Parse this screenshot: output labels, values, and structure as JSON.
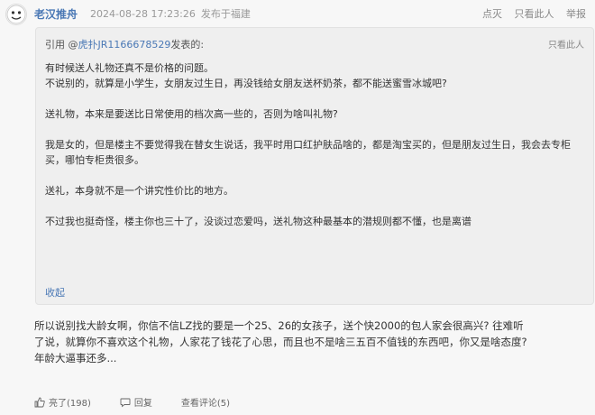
{
  "post": {
    "username": "老汉推舟",
    "timestamp": "2024-08-28 17:23:26",
    "location": "发布于福建",
    "actions": [
      "点灭",
      "只看此人",
      "举报"
    ]
  },
  "quote": {
    "prefix": "引用 @",
    "author": "虎扑JR1166678529",
    "suffix": " 发表的:",
    "only_this": "只看此人",
    "paragraphs": [
      "有时候送人礼物还真不是价格的问题。",
      "不说别的，就算是小学生，女朋友过生日，再没钱给女朋友送杯奶茶，都不能送蜜雪冰城吧?",
      "",
      "送礼物，本来是要送比日常使用的档次高一些的，否则为啥叫礼物?",
      "",
      "我是女的，但是楼主不要觉得我在替女生说话，我平时用口红护肤品啥的，都是淘宝买的，但是朋友过生日，我会去专柜买，哪怕专柜贵很多。",
      "",
      "送礼，本身就不是一个讲究性价比的地方。",
      "",
      "不过我也挺奇怪，楼主你也三十了，没谈过恋爱吗，送礼物这种最基本的潜规则都不懂，也是离谱"
    ],
    "collapse": "收起"
  },
  "reply": {
    "lines": [
      "所以说别找大龄女啊，你信不信LZ找的要是一个25、26的女孩子，送个快2000的包人家会很高兴?  往难听",
      "了说，就算你不喜欢这个礼物，人家花了钱花了心思，而且也不是啥三五百不值钱的东西吧，你又是啥态度?",
      "年龄大逼事还多..."
    ]
  },
  "footer": {
    "like": "亮了(198)",
    "comment_label": "回复",
    "view_comments": "查看评论(5)"
  },
  "colors": {
    "link": "#4a78b5",
    "quote_bg": "#efefef",
    "page_bg": "#f7f7f7"
  }
}
